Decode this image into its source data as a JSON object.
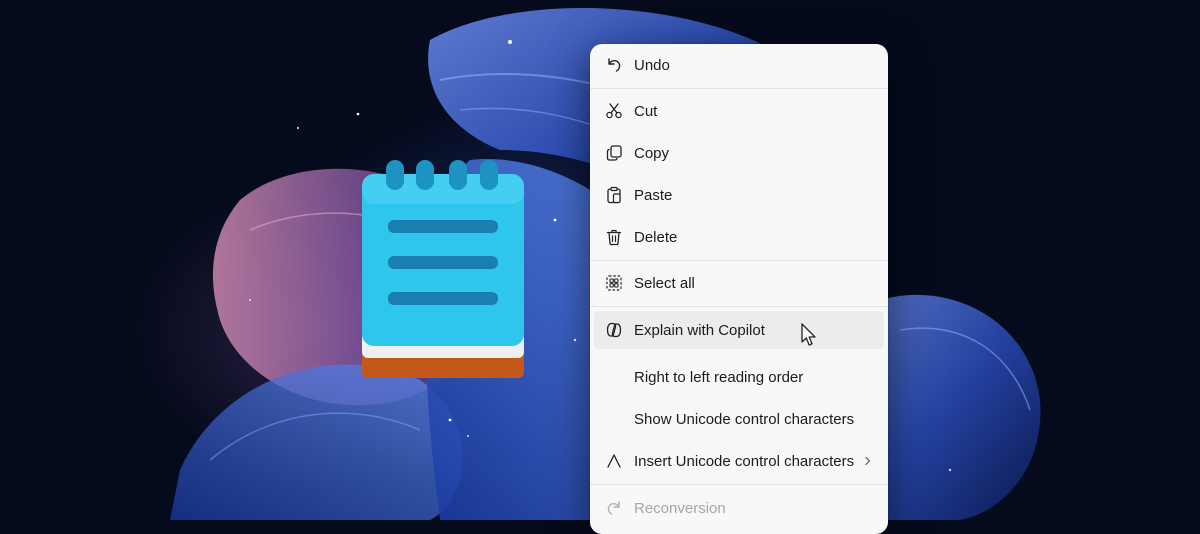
{
  "context_menu": {
    "items": [
      {
        "label": "Undo",
        "icon": "undo-icon"
      },
      {
        "label": "Cut",
        "icon": "scissors-icon"
      },
      {
        "label": "Copy",
        "icon": "copy-icon"
      },
      {
        "label": "Paste",
        "icon": "paste-icon"
      },
      {
        "label": "Delete",
        "icon": "trash-icon"
      },
      {
        "label": "Select all",
        "icon": "select-all-icon"
      },
      {
        "label": "Explain with Copilot",
        "icon": "copilot-icon"
      },
      {
        "label": "Right to left reading order",
        "icon": ""
      },
      {
        "label": "Show Unicode control characters",
        "icon": ""
      },
      {
        "label": "Insert Unicode control characters",
        "icon": "caret-up-icon"
      },
      {
        "label": "Reconversion",
        "icon": "redo-icon"
      }
    ],
    "hovered_item": "Explain with Copilot",
    "disabled_item": "Reconversion"
  },
  "desktop": {
    "app_icon": "notepad-icon",
    "colors": {
      "background": "#050a1c",
      "bloom_blue": "#2f5fd8",
      "bloom_pink": "#c97aa6",
      "notepad_cyan": "#2fc6ee",
      "notepad_orange": "#c4581a"
    }
  }
}
